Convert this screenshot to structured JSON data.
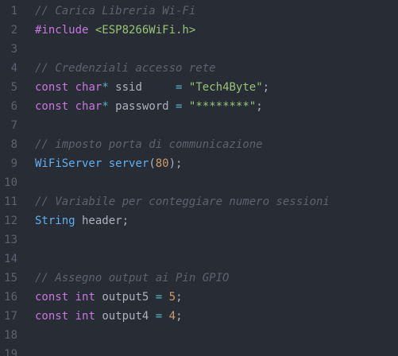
{
  "editor": {
    "colors": {
      "background": "#282c34",
      "line_number": "#5c6370",
      "comment": "#5c6370",
      "keyword": "#c678dd",
      "type": "#61afef",
      "string": "#98c379",
      "number": "#d19a66",
      "operator": "#56b6c2",
      "text": "#abb2bf"
    },
    "lines": [
      {
        "num": "1",
        "tokens": [
          {
            "t": "comment",
            "v": "// Carica Libreria Wi-Fi"
          }
        ]
      },
      {
        "num": "2",
        "tokens": [
          {
            "t": "pre",
            "v": "#include "
          },
          {
            "t": "include",
            "v": "<ESP8266WiFi.h>"
          }
        ]
      },
      {
        "num": "3",
        "tokens": []
      },
      {
        "num": "4",
        "tokens": [
          {
            "t": "comment",
            "v": "// Credenziali accesso rete"
          }
        ]
      },
      {
        "num": "5",
        "tokens": [
          {
            "t": "kw",
            "v": "const"
          },
          {
            "t": "plain",
            "v": " "
          },
          {
            "t": "kw",
            "v": "char"
          },
          {
            "t": "op",
            "v": "*"
          },
          {
            "t": "plain",
            "v": " ssid     "
          },
          {
            "t": "op",
            "v": "="
          },
          {
            "t": "plain",
            "v": " "
          },
          {
            "t": "str",
            "v": "\"Tech4Byte\""
          },
          {
            "t": "plain",
            "v": ";"
          }
        ]
      },
      {
        "num": "6",
        "tokens": [
          {
            "t": "kw",
            "v": "const"
          },
          {
            "t": "plain",
            "v": " "
          },
          {
            "t": "kw",
            "v": "char"
          },
          {
            "t": "op",
            "v": "*"
          },
          {
            "t": "plain",
            "v": " password "
          },
          {
            "t": "op",
            "v": "="
          },
          {
            "t": "plain",
            "v": " "
          },
          {
            "t": "str",
            "v": "\"********\""
          },
          {
            "t": "plain",
            "v": ";"
          }
        ]
      },
      {
        "num": "7",
        "tokens": []
      },
      {
        "num": "8",
        "tokens": [
          {
            "t": "comment",
            "v": "// imposto porta di communicazione"
          }
        ]
      },
      {
        "num": "9",
        "tokens": [
          {
            "t": "type",
            "v": "WiFiServer"
          },
          {
            "t": "plain",
            "v": " "
          },
          {
            "t": "fn",
            "v": "server"
          },
          {
            "t": "plain",
            "v": "("
          },
          {
            "t": "num",
            "v": "80"
          },
          {
            "t": "plain",
            "v": ");"
          }
        ]
      },
      {
        "num": "10",
        "tokens": []
      },
      {
        "num": "11",
        "tokens": [
          {
            "t": "comment",
            "v": "// Variabile per conteggiare numero sessioni"
          }
        ]
      },
      {
        "num": "12",
        "tokens": [
          {
            "t": "type",
            "v": "String"
          },
          {
            "t": "plain",
            "v": " header;"
          }
        ]
      },
      {
        "num": "13",
        "tokens": []
      },
      {
        "num": "14",
        "tokens": []
      },
      {
        "num": "15",
        "tokens": [
          {
            "t": "comment",
            "v": "// Assegno output ai Pin GPIO"
          }
        ]
      },
      {
        "num": "16",
        "tokens": [
          {
            "t": "kw",
            "v": "const"
          },
          {
            "t": "plain",
            "v": " "
          },
          {
            "t": "kw",
            "v": "int"
          },
          {
            "t": "plain",
            "v": " output5 "
          },
          {
            "t": "op",
            "v": "="
          },
          {
            "t": "plain",
            "v": " "
          },
          {
            "t": "num",
            "v": "5"
          },
          {
            "t": "plain",
            "v": ";"
          }
        ]
      },
      {
        "num": "17",
        "tokens": [
          {
            "t": "kw",
            "v": "const"
          },
          {
            "t": "plain",
            "v": " "
          },
          {
            "t": "kw",
            "v": "int"
          },
          {
            "t": "plain",
            "v": " output4 "
          },
          {
            "t": "op",
            "v": "="
          },
          {
            "t": "plain",
            "v": " "
          },
          {
            "t": "num",
            "v": "4"
          },
          {
            "t": "plain",
            "v": ";"
          }
        ]
      },
      {
        "num": "18",
        "tokens": []
      },
      {
        "num": "19",
        "tokens": []
      }
    ]
  }
}
